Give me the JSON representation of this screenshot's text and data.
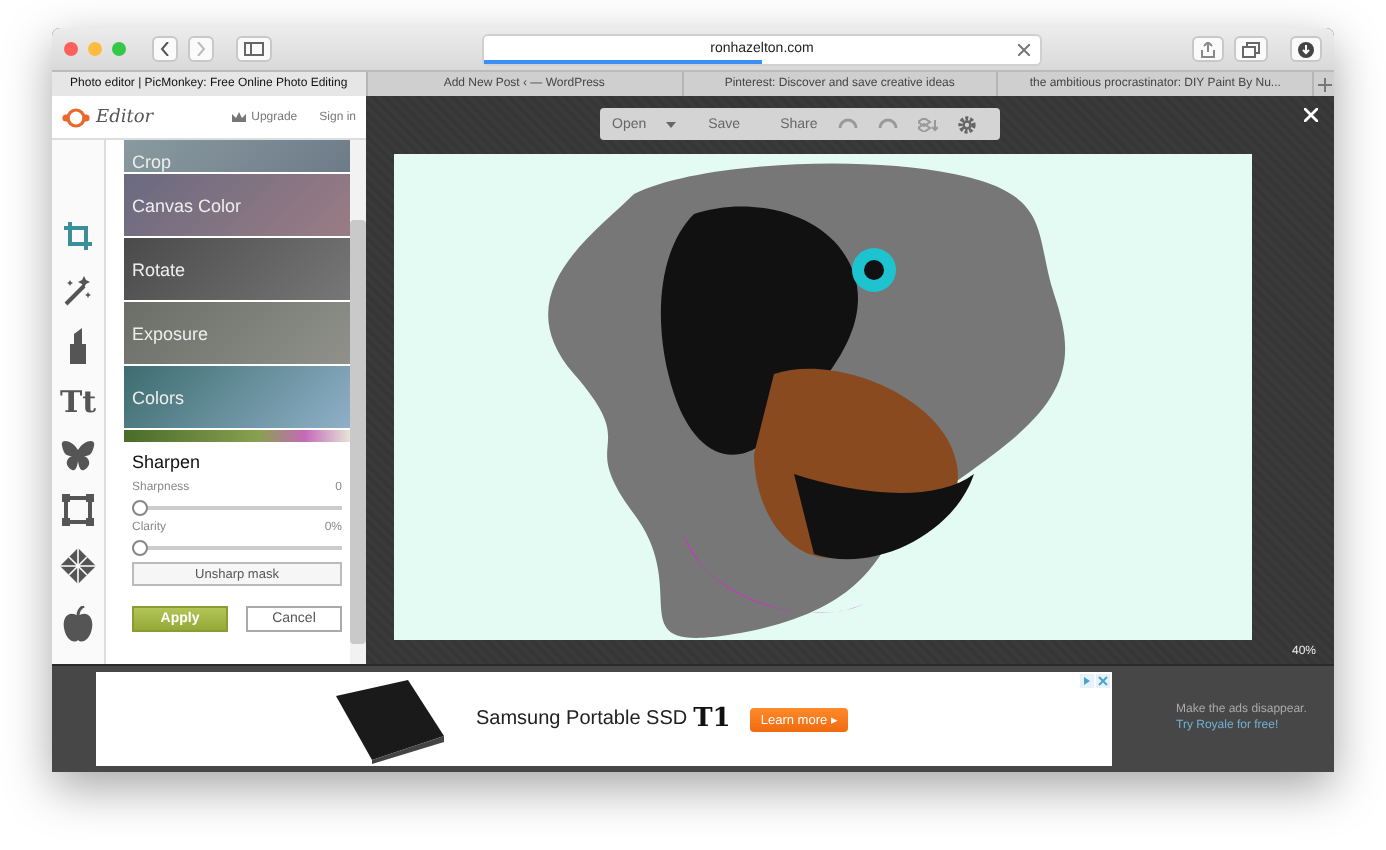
{
  "browser": {
    "url": "ronhazelton.com",
    "progress": {
      "level": 0.5
    }
  },
  "tabs": [
    {
      "label": "Photo editor | PicMonkey: Free Online Photo Editing",
      "selected": true
    },
    {
      "label": "Add New Post ‹ — WordPress",
      "selected": false
    },
    {
      "label": "Pinterest: Discover and save creative ideas",
      "selected": false
    },
    {
      "label": "the ambitious procrastinator: DIY Paint By Nu...",
      "selected": false
    }
  ],
  "editor": {
    "logo": "Editor",
    "upgrade": "Upgrade",
    "sign_in": "Sign in",
    "tools": [
      {
        "kind": "crop",
        "selected": true
      },
      {
        "kind": "wand",
        "selected": false
      },
      {
        "kind": "lipstick",
        "selected": false
      },
      {
        "kind": "text",
        "label": "Tt",
        "selected": false
      },
      {
        "kind": "butterfly",
        "selected": false
      },
      {
        "kind": "frame",
        "selected": false
      },
      {
        "kind": "texture",
        "selected": false
      },
      {
        "kind": "apple",
        "selected": false
      }
    ],
    "menu": [
      {
        "label": "Crop",
        "cut": true
      },
      {
        "label": "Canvas Color"
      },
      {
        "label": "Rotate"
      },
      {
        "label": "Exposure"
      },
      {
        "label": "Colors"
      }
    ],
    "panel": {
      "title": "Sharpen",
      "sliders": [
        {
          "name": "Sharpness",
          "reading": "0",
          "level": 0
        },
        {
          "name": "Clarity",
          "reading": "0%",
          "level": 0
        }
      ],
      "option_button": "Unsharp mask",
      "apply": "Apply",
      "cancel": "Cancel"
    }
  },
  "toolbar": {
    "open": "Open",
    "save": "Save",
    "share": "Share"
  },
  "canvas": {
    "zoom": "40%"
  },
  "ad": {
    "headline": "Samsung Portable SSD",
    "model": "T1",
    "cta": "Learn more ▸",
    "aside": "Make the ads disappear.",
    "aside_link": "Try Royale for free!"
  }
}
